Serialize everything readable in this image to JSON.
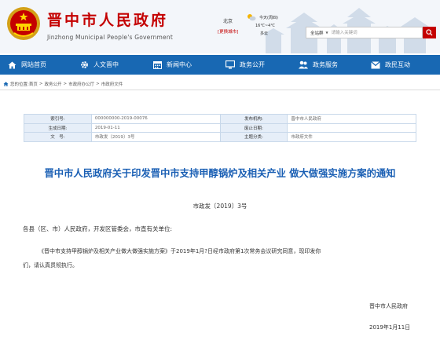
{
  "header": {
    "title": "晋中市人民政府",
    "subtitle": "Jinzhong Municipal People's Government",
    "city": "北京",
    "switch_city": "[更换城市]",
    "weather_today": "今天(周四)",
    "weather_temp": "16℃~4℃",
    "weather_wind": "多云",
    "search_scope": "全站群",
    "search_placeholder": "请输入关键词",
    "brand_color": "#c40000"
  },
  "nav": {
    "color": "#1868b3",
    "items": [
      {
        "label": "网站首页",
        "icon": "home-icon"
      },
      {
        "label": "人文晋中",
        "icon": "gear-icon"
      },
      {
        "label": "新闻中心",
        "icon": "calendar-icon"
      },
      {
        "label": "政务公开",
        "icon": "monitor-icon"
      },
      {
        "label": "政务服务",
        "icon": "people-icon"
      },
      {
        "label": "政民互动",
        "icon": "mail-icon"
      }
    ]
  },
  "breadcrumb": {
    "prefix": "您的位置:",
    "items": [
      "首页",
      "政务公开",
      "市政府办公厅",
      "市政府文件"
    ],
    "separator": ">"
  },
  "meta": {
    "rows": [
      {
        "l1": "索引号:",
        "v1": "000000000-2019-00076",
        "l2": "发布机构:",
        "v2": "晋中市人民政府"
      },
      {
        "l1": "生成日期:",
        "v1": "2019-01-11",
        "l2": "废止日期:",
        "v2": ""
      },
      {
        "l1": "文　号:",
        "v1": "市政发〔2019〕3号",
        "l2": "主题分类:",
        "v2": "市政府文件"
      }
    ]
  },
  "document": {
    "title": "晋中市人民政府关于印发晋中市支持甲醇锅炉及相关产业 做大做强实施方案的通知",
    "number": "市政发〔2019〕3号",
    "recipients": "各县（区、市）人民政府，开发区管委会，市直有关单位:",
    "body_line1": "《晋中市支持甲醇锅炉及相关产业做大做强实施方案》于2019年1月?日经市政府第1次常务会议研究同意，现印发你",
    "body_line2": "们，请认真贯彻执行。",
    "signature": "晋中市人民政府",
    "date": "2019年1月11日"
  }
}
